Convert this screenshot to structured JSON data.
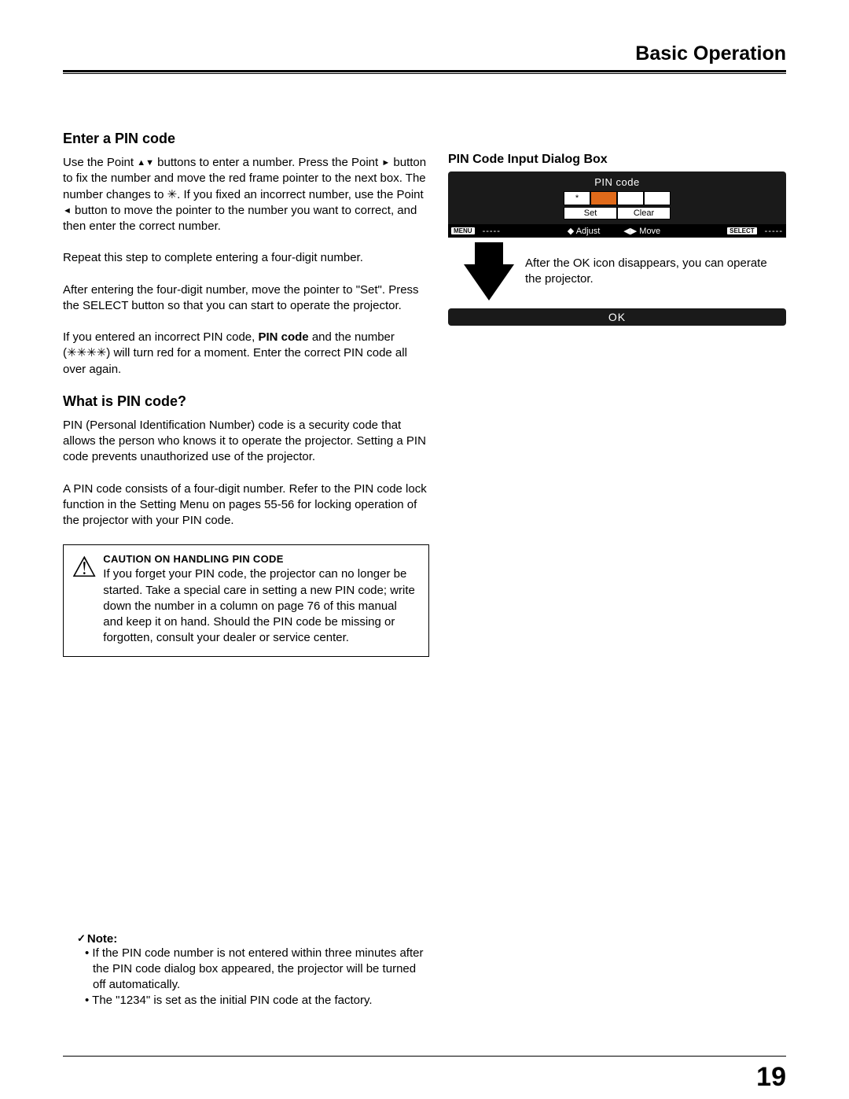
{
  "header": {
    "title": "Basic Operation"
  },
  "left": {
    "h1": "Enter a PIN code",
    "p1a": "Use the Point ",
    "p1b": " buttons to enter a number. Press the Point ",
    "p1c": " button to fix the number and move the red frame pointer to the next box. The number changes to ",
    "p1d": ". If you fixed an incorrect number, use the Point ",
    "p1e": " button to move the pointer to the number you want to correct, and then enter the correct number.",
    "tri_updown": "▲▼",
    "tri_right": "►",
    "tri_left": "◄",
    "asterisk1": "✳",
    "p2": "Repeat this step to complete entering a four-digit number.",
    "p3": "After entering the four-digit number, move the pointer to \"Set\". Press the SELECT button so that you can start to operate the projector.",
    "p4a": "If you entered an incorrect PIN code, ",
    "p4bold": "PIN code",
    "p4b": " and the number (",
    "p4ast": "✳✳✳✳",
    "p4c": ") will turn red for a moment. Enter the correct PIN code all over again.",
    "h2": "What is PIN code?",
    "p5": "PIN (Personal Identification Number) code is a security code that allows the person who knows it to operate the projector. Setting a PIN code prevents unauthorized use of the projector.",
    "p6": "A PIN code consists of a four-digit number. Refer to the PIN code lock function in the Setting Menu on pages 55-56 for locking operation of the projector with your PIN code.",
    "caution_title": "CAUTION ON HANDLING PIN CODE",
    "caution_text": "If you forget your PIN code, the projector can no longer be started. Take a special care in setting a new PIN code; write down the number in a column on page 76 of this manual and keep it on hand. Should the PIN code be missing or forgotten, consult your dealer or service center.",
    "note_head": "Note:",
    "note1": "If the PIN code number is not entered within three minutes after the PIN code dialog box appeared, the projector will be turned off automatically.",
    "note2": "The \"1234\" is set as the initial PIN code at the factory."
  },
  "right": {
    "title": "PIN Code Input Dialog Box",
    "pin_label": "PIN code",
    "cell1": "*",
    "btn_set": "Set",
    "btn_clear": "Clear",
    "hint_menu": "MENU",
    "hint_dash": "-----",
    "hint_adjust": "Adjust",
    "hint_move": "Move",
    "hint_select": "SELECT",
    "hint_updown": "◆",
    "hint_lr": "◀▶",
    "after_text": "After the OK icon disappears, you can operate the projector.",
    "ok": "OK"
  },
  "footer": {
    "page": "19"
  }
}
